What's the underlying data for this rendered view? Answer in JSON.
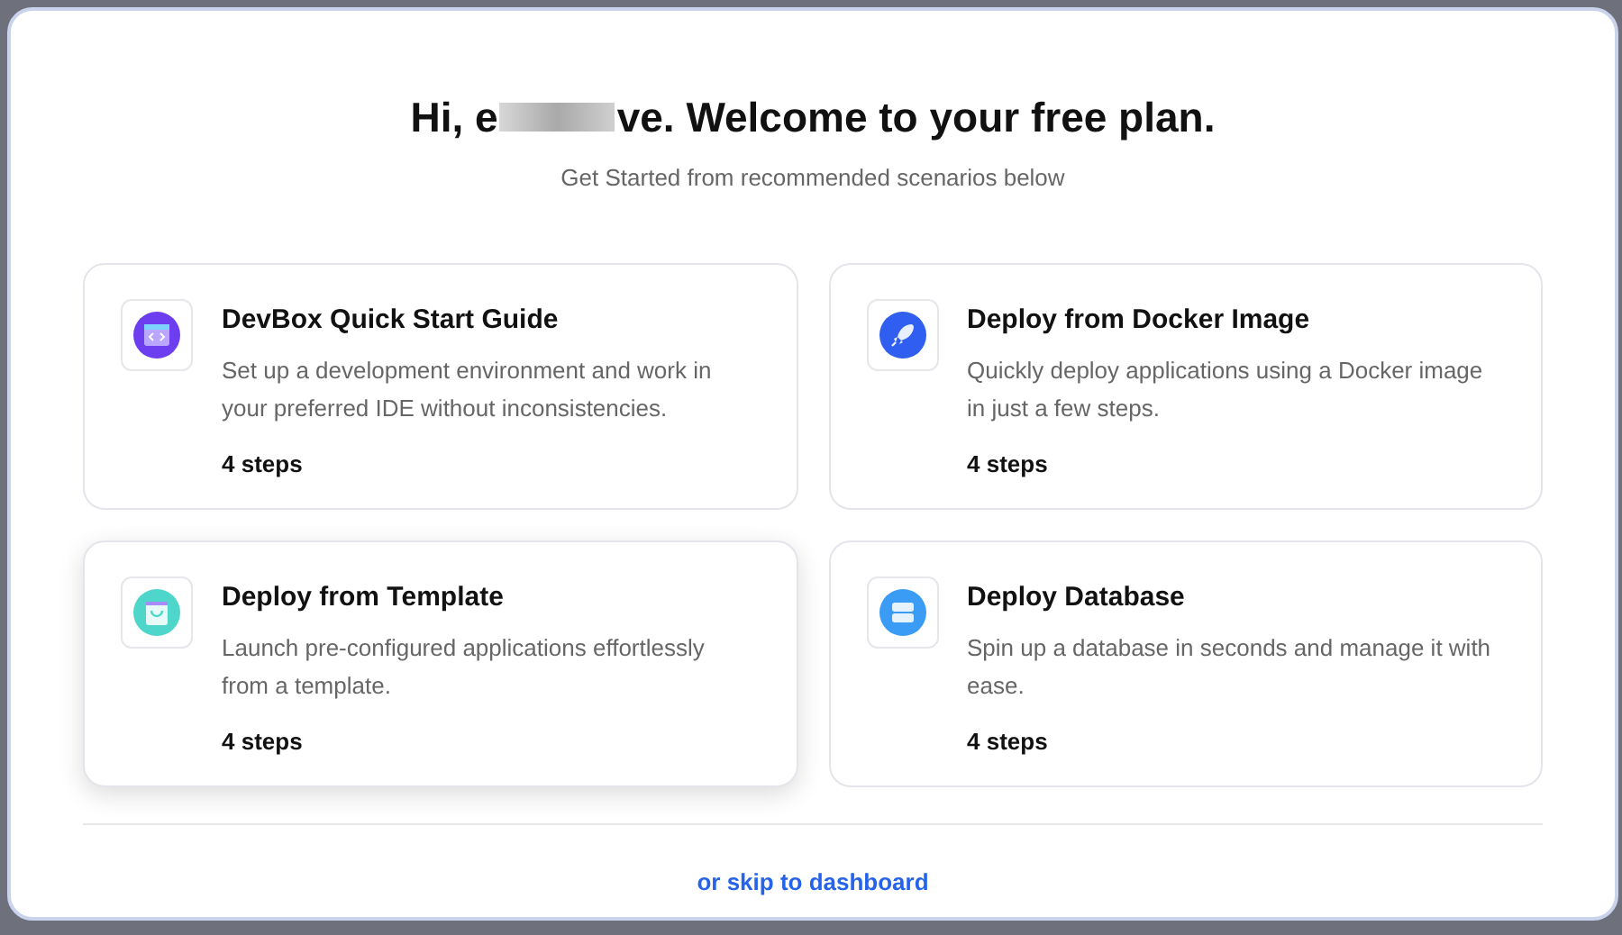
{
  "heading": {
    "before_redaction": "Hi, e",
    "after_redaction": "ve. Welcome to your free plan."
  },
  "subtitle": "Get Started from recommended scenarios below",
  "cards": [
    {
      "kind": "devbox",
      "title": "DevBox Quick Start Guide",
      "description": "Set up a development environment and work in your preferred IDE without inconsistencies.",
      "steps": "4 steps",
      "hovered": false
    },
    {
      "kind": "docker",
      "title": "Deploy from Docker Image",
      "description": "Quickly deploy applications using a Docker image in just a few steps.",
      "steps": "4 steps",
      "hovered": false
    },
    {
      "kind": "template",
      "title": "Deploy from Template",
      "description": "Launch pre-configured applications effortlessly from a template.",
      "steps": "4 steps",
      "hovered": true
    },
    {
      "kind": "database",
      "title": "Deploy Database",
      "description": "Spin up a database in seconds and manage it with ease.",
      "steps": "4 steps",
      "hovered": false
    }
  ],
  "skip_link": "or skip to dashboard"
}
